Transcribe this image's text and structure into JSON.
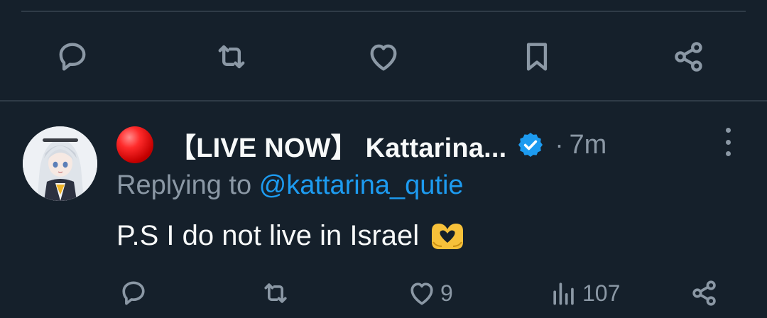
{
  "previous_tweet_actions": {
    "icons": [
      "reply-icon",
      "retweet-icon",
      "like-icon",
      "bookmark-icon",
      "share-icon"
    ]
  },
  "reply": {
    "display_name": "【LIVE NOW】 Kattarina...",
    "verified": true,
    "separator": "·",
    "timestamp": "7m",
    "replying_to_prefix": "Replying to ",
    "replying_to_handle": "@kattarina_qutie",
    "text": "P.S I do not live in Israel",
    "emoji": "heart-hands-emoji",
    "actions": {
      "reply_count": "",
      "retweet_count": "",
      "like_count": "9",
      "views_count": "107"
    }
  },
  "colors": {
    "background": "#15202b",
    "text_primary": "#f7f9f9",
    "text_secondary": "#8b98a5",
    "accent": "#1d9bf0",
    "divider": "#2f3b47"
  }
}
